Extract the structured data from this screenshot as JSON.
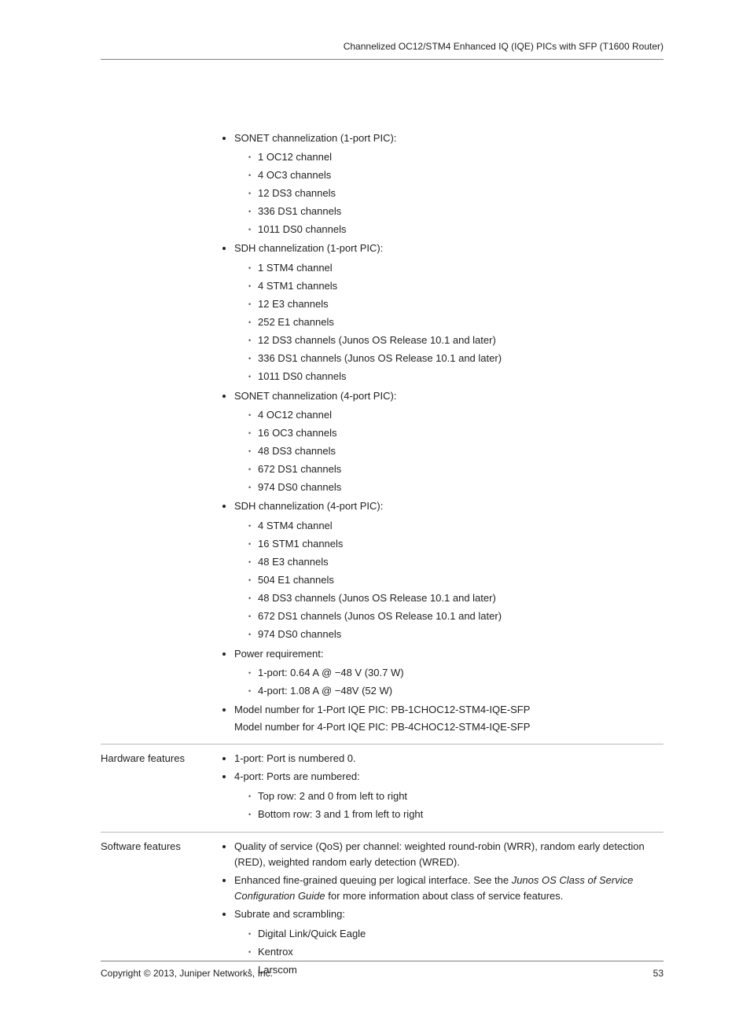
{
  "header": {
    "title": "Channelized OC12/STM4 Enhanced IQ (IQE) PICs with SFP (T1600 Router)"
  },
  "spec": {
    "groups": [
      {
        "title": "SONET channelization (1-port PIC):",
        "items": [
          "1 OC12 channel",
          "4 OC3 channels",
          "12 DS3 channels",
          "336 DS1 channels",
          "1011 DS0 channels"
        ]
      },
      {
        "title": "SDH channelization (1-port PIC):",
        "items": [
          "1 STM4 channel",
          "4 STM1 channels",
          "12 E3 channels",
          "252 E1 channels",
          "12 DS3 channels (Junos OS Release 10.1 and later)",
          "336 DS1 channels (Junos OS Release 10.1 and later)",
          "1011 DS0 channels"
        ]
      },
      {
        "title": "SONET channelization (4-port PIC):",
        "items": [
          "4 OC12 channel",
          "16 OC3 channels",
          "48 DS3 channels",
          "672 DS1 channels",
          "974 DS0 channels"
        ]
      },
      {
        "title": "SDH channelization (4-port PIC):",
        "items": [
          "4 STM4 channel",
          "16 STM1 channels",
          "48 E3 channels",
          "504 E1 channels",
          "48 DS3 channels (Junos OS Release 10.1 and later)",
          "672 DS1 channels (Junos OS Release 10.1 and later)",
          "974 DS0 channels"
        ]
      },
      {
        "title": "Power requirement:",
        "items": [
          "1-port: 0.64 A @ −48 V (30.7 W)",
          "4-port: 1.08 A @ −48V (52 W)"
        ]
      }
    ],
    "model1": "Model number for 1-Port IQE PIC: PB-1CHOC12-STM4-IQE-SFP",
    "model2": "Model number for 4-Port IQE PIC: PB-4CHOC12-STM4-IQE-SFP"
  },
  "hardware": {
    "label": "Hardware features",
    "line1": "1-port: Port is numbered 0.",
    "line2": "4-port: Ports are numbered:",
    "items": [
      "Top row: 2 and 0 from left to right",
      "Bottom row: 3 and 1 from left to right"
    ]
  },
  "software": {
    "label": "Software features",
    "qos": "Quality of service (QoS) per channel: weighted round-robin (WRR), random early detection (RED), weighted random early detection (WRED).",
    "queuing_pre": "Enhanced fine-grained queuing per logical interface. See the ",
    "queuing_em": "Junos OS Class of Service Configuration Guide",
    "queuing_post": " for more information about class of service features.",
    "subrate_title": "Subrate and scrambling:",
    "subrate_items": [
      "Digital Link/Quick Eagle",
      "Kentrox",
      "Larscom"
    ]
  },
  "footer": {
    "copyright": "Copyright © 2013, Juniper Networks, Inc.",
    "page": "53"
  }
}
